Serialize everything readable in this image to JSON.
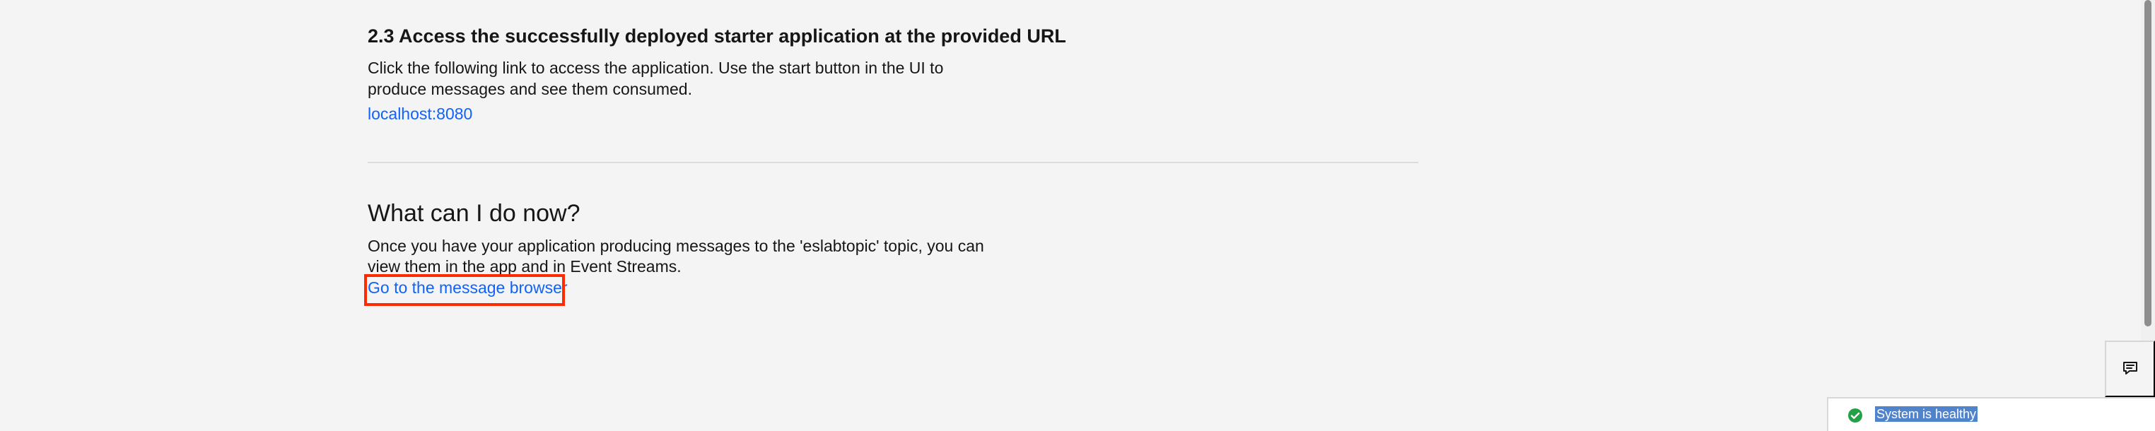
{
  "section": {
    "step_title": "2.3 Access the successfully deployed starter application at the provided URL",
    "step_description": "Click the following link to access the application. Use the start button in the UI to produce messages and see them consumed.",
    "step_link": "localhost:8080"
  },
  "next_steps": {
    "title": "What can I do now?",
    "description": "Once you have your application producing messages to the 'eslabtopic' topic, you can view them in the app and in Event Streams.",
    "link_label": "Go to the message browser"
  },
  "status": {
    "text": "System is healthy",
    "icon": "checkmark-filled-icon",
    "color": "#24a148"
  },
  "feedback": {
    "icon": "chat-icon"
  },
  "colors": {
    "link": "#0f62fe",
    "highlight": "#ff2a00",
    "background": "#f4f4f4"
  }
}
